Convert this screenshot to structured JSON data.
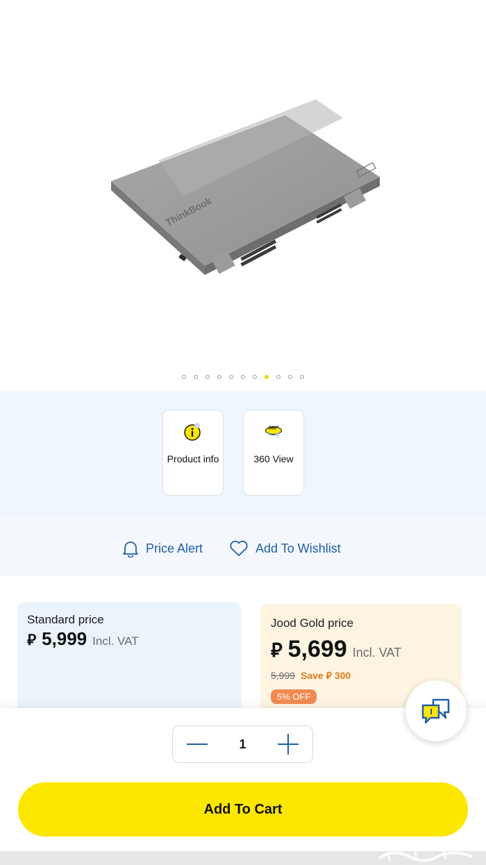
{
  "gallery": {
    "image_alt": "",
    "laptop_brand_mark": "ThinkBook",
    "dots_total": 11,
    "active_dot": 7
  },
  "features": [
    {
      "label": "Product info",
      "icon": "info-icon"
    },
    {
      "label": "360 View",
      "icon": "360-view-icon",
      "icon_text": "360°"
    }
  ],
  "actions": {
    "price_alert": "Price Alert",
    "wishlist": "Add To Wishlist"
  },
  "standard": {
    "label": "Standard price",
    "currency": "⃁",
    "amount": "5,999",
    "vat": "Incl. VAT"
  },
  "gold": {
    "label": "Jood Gold price",
    "currency": "⃁",
    "amount": "5,699",
    "vat": "Incl. VAT",
    "old_price": "5,999",
    "save_text": "Save ⃁ 300",
    "badge": "5% OFF"
  },
  "cart": {
    "quantity": "1",
    "button": "Add To Cart"
  },
  "colors": {
    "accent_yellow": "#fde600",
    "link_blue": "#1e5fa8",
    "save_orange": "#e07a1f"
  }
}
